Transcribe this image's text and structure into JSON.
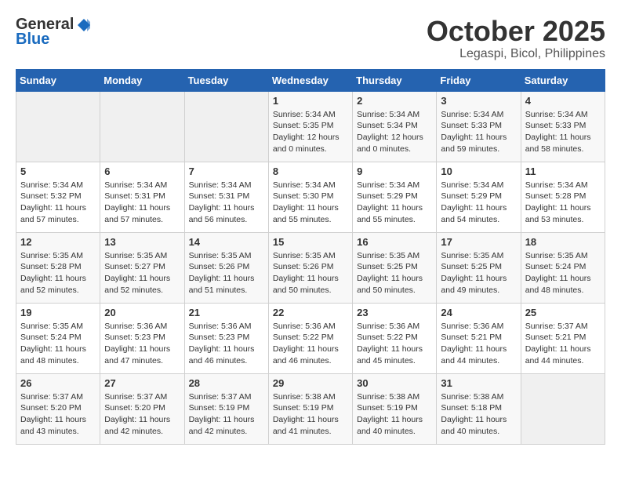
{
  "header": {
    "logo_general": "General",
    "logo_blue": "Blue",
    "month": "October 2025",
    "location": "Legaspi, Bicol, Philippines"
  },
  "days_of_week": [
    "Sunday",
    "Monday",
    "Tuesday",
    "Wednesday",
    "Thursday",
    "Friday",
    "Saturday"
  ],
  "weeks": [
    [
      {
        "day": "",
        "info": ""
      },
      {
        "day": "",
        "info": ""
      },
      {
        "day": "",
        "info": ""
      },
      {
        "day": "1",
        "info": "Sunrise: 5:34 AM\nSunset: 5:35 PM\nDaylight: 12 hours\nand 0 minutes."
      },
      {
        "day": "2",
        "info": "Sunrise: 5:34 AM\nSunset: 5:34 PM\nDaylight: 12 hours\nand 0 minutes."
      },
      {
        "day": "3",
        "info": "Sunrise: 5:34 AM\nSunset: 5:33 PM\nDaylight: 11 hours\nand 59 minutes."
      },
      {
        "day": "4",
        "info": "Sunrise: 5:34 AM\nSunset: 5:33 PM\nDaylight: 11 hours\nand 58 minutes."
      }
    ],
    [
      {
        "day": "5",
        "info": "Sunrise: 5:34 AM\nSunset: 5:32 PM\nDaylight: 11 hours\nand 57 minutes."
      },
      {
        "day": "6",
        "info": "Sunrise: 5:34 AM\nSunset: 5:31 PM\nDaylight: 11 hours\nand 57 minutes."
      },
      {
        "day": "7",
        "info": "Sunrise: 5:34 AM\nSunset: 5:31 PM\nDaylight: 11 hours\nand 56 minutes."
      },
      {
        "day": "8",
        "info": "Sunrise: 5:34 AM\nSunset: 5:30 PM\nDaylight: 11 hours\nand 55 minutes."
      },
      {
        "day": "9",
        "info": "Sunrise: 5:34 AM\nSunset: 5:29 PM\nDaylight: 11 hours\nand 55 minutes."
      },
      {
        "day": "10",
        "info": "Sunrise: 5:34 AM\nSunset: 5:29 PM\nDaylight: 11 hours\nand 54 minutes."
      },
      {
        "day": "11",
        "info": "Sunrise: 5:34 AM\nSunset: 5:28 PM\nDaylight: 11 hours\nand 53 minutes."
      }
    ],
    [
      {
        "day": "12",
        "info": "Sunrise: 5:35 AM\nSunset: 5:28 PM\nDaylight: 11 hours\nand 52 minutes."
      },
      {
        "day": "13",
        "info": "Sunrise: 5:35 AM\nSunset: 5:27 PM\nDaylight: 11 hours\nand 52 minutes."
      },
      {
        "day": "14",
        "info": "Sunrise: 5:35 AM\nSunset: 5:26 PM\nDaylight: 11 hours\nand 51 minutes."
      },
      {
        "day": "15",
        "info": "Sunrise: 5:35 AM\nSunset: 5:26 PM\nDaylight: 11 hours\nand 50 minutes."
      },
      {
        "day": "16",
        "info": "Sunrise: 5:35 AM\nSunset: 5:25 PM\nDaylight: 11 hours\nand 50 minutes."
      },
      {
        "day": "17",
        "info": "Sunrise: 5:35 AM\nSunset: 5:25 PM\nDaylight: 11 hours\nand 49 minutes."
      },
      {
        "day": "18",
        "info": "Sunrise: 5:35 AM\nSunset: 5:24 PM\nDaylight: 11 hours\nand 48 minutes."
      }
    ],
    [
      {
        "day": "19",
        "info": "Sunrise: 5:35 AM\nSunset: 5:24 PM\nDaylight: 11 hours\nand 48 minutes."
      },
      {
        "day": "20",
        "info": "Sunrise: 5:36 AM\nSunset: 5:23 PM\nDaylight: 11 hours\nand 47 minutes."
      },
      {
        "day": "21",
        "info": "Sunrise: 5:36 AM\nSunset: 5:23 PM\nDaylight: 11 hours\nand 46 minutes."
      },
      {
        "day": "22",
        "info": "Sunrise: 5:36 AM\nSunset: 5:22 PM\nDaylight: 11 hours\nand 46 minutes."
      },
      {
        "day": "23",
        "info": "Sunrise: 5:36 AM\nSunset: 5:22 PM\nDaylight: 11 hours\nand 45 minutes."
      },
      {
        "day": "24",
        "info": "Sunrise: 5:36 AM\nSunset: 5:21 PM\nDaylight: 11 hours\nand 44 minutes."
      },
      {
        "day": "25",
        "info": "Sunrise: 5:37 AM\nSunset: 5:21 PM\nDaylight: 11 hours\nand 44 minutes."
      }
    ],
    [
      {
        "day": "26",
        "info": "Sunrise: 5:37 AM\nSunset: 5:20 PM\nDaylight: 11 hours\nand 43 minutes."
      },
      {
        "day": "27",
        "info": "Sunrise: 5:37 AM\nSunset: 5:20 PM\nDaylight: 11 hours\nand 42 minutes."
      },
      {
        "day": "28",
        "info": "Sunrise: 5:37 AM\nSunset: 5:19 PM\nDaylight: 11 hours\nand 42 minutes."
      },
      {
        "day": "29",
        "info": "Sunrise: 5:38 AM\nSunset: 5:19 PM\nDaylight: 11 hours\nand 41 minutes."
      },
      {
        "day": "30",
        "info": "Sunrise: 5:38 AM\nSunset: 5:19 PM\nDaylight: 11 hours\nand 40 minutes."
      },
      {
        "day": "31",
        "info": "Sunrise: 5:38 AM\nSunset: 5:18 PM\nDaylight: 11 hours\nand 40 minutes."
      },
      {
        "day": "",
        "info": ""
      }
    ]
  ]
}
